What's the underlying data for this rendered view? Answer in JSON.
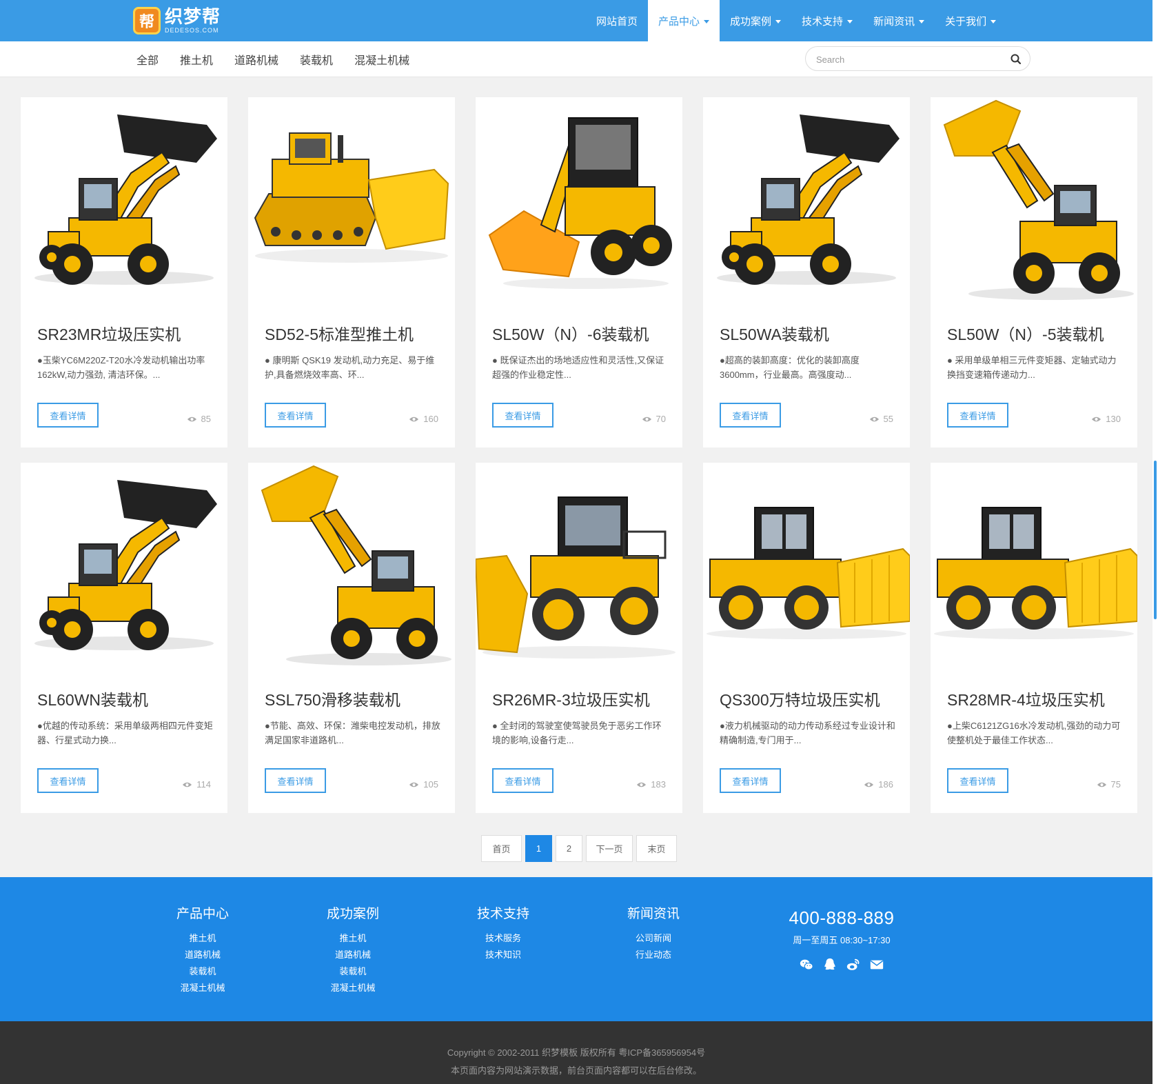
{
  "header": {
    "logo_char": "帮",
    "logo_name": "织梦帮",
    "logo_sub": "DEDESOS.COM",
    "nav": [
      {
        "label": "网站首页",
        "dropdown": false,
        "active": false
      },
      {
        "label": "产品中心",
        "dropdown": true,
        "active": true
      },
      {
        "label": "成功案例",
        "dropdown": true,
        "active": false
      },
      {
        "label": "技术支持",
        "dropdown": true,
        "active": false
      },
      {
        "label": "新闻资讯",
        "dropdown": true,
        "active": false
      },
      {
        "label": "关于我们",
        "dropdown": true,
        "active": false
      }
    ]
  },
  "subnav": {
    "items": [
      "全部",
      "推土机",
      "道路机械",
      "装载机",
      "混凝土机械"
    ],
    "search_placeholder": "Search",
    "search_value": ""
  },
  "products": [
    {
      "title": "SR23MR垃圾压实机",
      "desc": "●玉柴YC6M220Z-T20水冷发动机输出功率162kW,动力强劲, 清洁环保。...",
      "button": "查看详情",
      "views": "85",
      "image": "wheel-loader-black-bucket"
    },
    {
      "title": "SD52-5标准型推土机",
      "desc": "● 康明斯 QSK19 发动机,动力充足、易于维护,具备燃烧效率高、环...",
      "button": "查看详情",
      "views": "160",
      "image": "crawler-bulldozer"
    },
    {
      "title": "SL50W（N）-6装载机",
      "desc": "● 既保证杰出的场地适应性和灵活性,又保证超强的作业稳定性...",
      "button": "查看详情",
      "views": "70",
      "image": "skid-steer-loader"
    },
    {
      "title": "SL50WA装载机",
      "desc": "●超高的装卸高度：优化的装卸高度3600mm，行业最高。高强度动...",
      "button": "查看详情",
      "views": "55",
      "image": "wheel-loader-black-bucket"
    },
    {
      "title": "SL50W（N）-5装载机",
      "desc": "● 采用单级单相三元件变矩器、定轴式动力换挡变速箱传递动力...",
      "button": "查看详情",
      "views": "130",
      "image": "wheel-loader-raised-bucket"
    },
    {
      "title": "SL60WN装载机",
      "desc": "●优越的传动系统：采用单级两相四元件变矩器、行星式动力换...",
      "button": "查看详情",
      "views": "114",
      "image": "wheel-loader-black-bucket"
    },
    {
      "title": "SSL750滑移装载机",
      "desc": "●节能、高效、环保：潍柴电控发动机，排放满足国家非道路机...",
      "button": "查看详情",
      "views": "105",
      "image": "wheel-loader-raised-bucket"
    },
    {
      "title": "SR26MR-3垃圾压实机",
      "desc": "● 全封闭的驾驶室使驾驶员免于恶劣工作环境的影响,设备行走...",
      "button": "查看详情",
      "views": "183",
      "image": "landfill-compactor-front"
    },
    {
      "title": "QS300万特垃圾压实机",
      "desc": "●液力机械驱动的动力传动系经过专业设计和精确制造,专门用于...",
      "button": "查看详情",
      "views": "186",
      "image": "landfill-compactor-side"
    },
    {
      "title": "SR28MR-4垃圾压实机",
      "desc": "●上柴C6121ZG16水冷发动机,强劲的动力可使整机处于最佳工作状态...",
      "button": "查看详情",
      "views": "75",
      "image": "landfill-compactor-side"
    }
  ],
  "pagination": {
    "first": "首页",
    "pages": [
      "1",
      "2"
    ],
    "current": "1",
    "next": "下一页",
    "last": "末页"
  },
  "footer": {
    "columns": [
      {
        "title": "产品中心",
        "links": [
          "推土机",
          "道路机械",
          "装载机",
          "混凝土机械"
        ]
      },
      {
        "title": "成功案例",
        "links": [
          "推土机",
          "道路机械",
          "装载机",
          "混凝土机械"
        ]
      },
      {
        "title": "技术支持",
        "links": [
          "技术服务",
          "技术知识"
        ]
      },
      {
        "title": "新闻资讯",
        "links": [
          "公司新闻",
          "行业动态"
        ]
      }
    ],
    "phone": "400-888-889",
    "hours": "周一至周五 08:30~17:30",
    "social_icons": [
      "wechat-icon",
      "qq-icon",
      "weibo-icon",
      "mail-icon"
    ],
    "copyright_line1": "Copyright © 2002-2011 织梦模板 版权所有 粤ICP备365956954号",
    "copyright_line2": "本页面内容为网站演示数据，前台页面内容都可以在后台修改。"
  },
  "colors": {
    "primary": "#3a9be5",
    "footer": "#1e88e5",
    "bottom": "#333333",
    "machine_yellow": "#f5b800"
  }
}
